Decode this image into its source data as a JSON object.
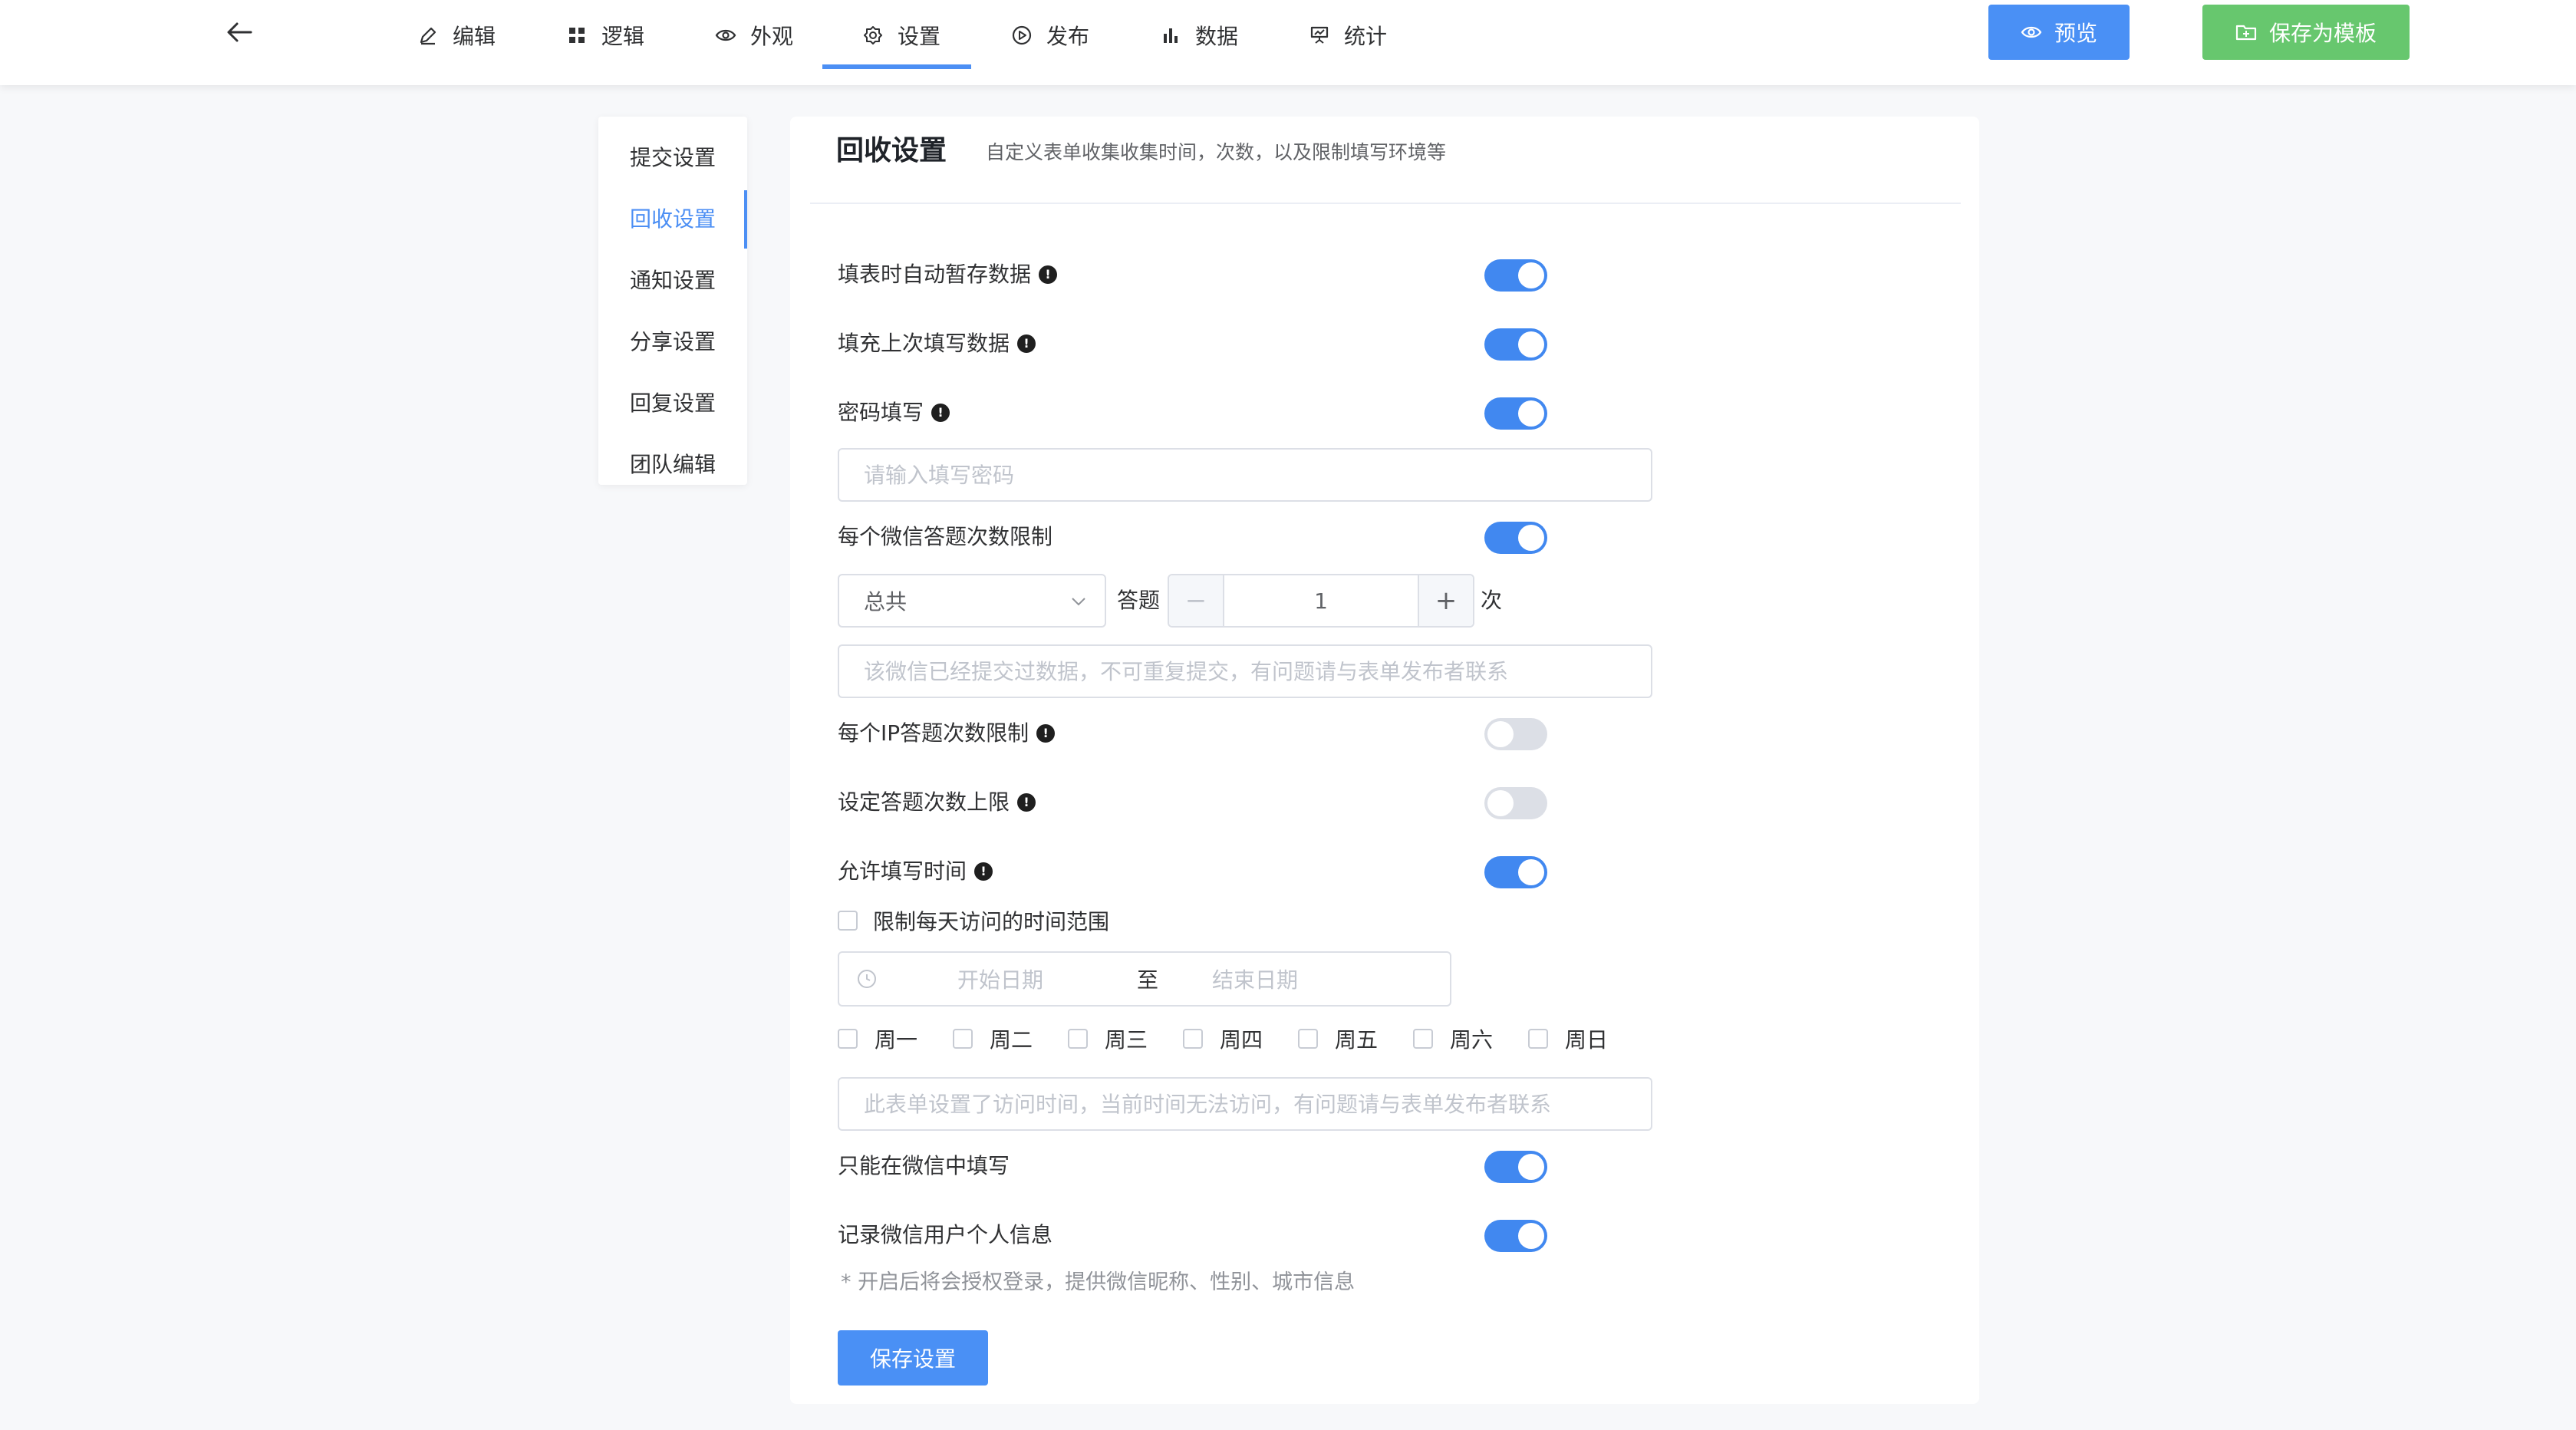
{
  "header": {
    "tabs": [
      {
        "label": "编辑",
        "icon": "edit-icon"
      },
      {
        "label": "逻辑",
        "icon": "grid-icon"
      },
      {
        "label": "外观",
        "icon": "eye-icon"
      },
      {
        "label": "设置",
        "icon": "gear-icon",
        "active": true
      },
      {
        "label": "发布",
        "icon": "play-icon"
      },
      {
        "label": "数据",
        "icon": "bar-chart-icon"
      },
      {
        "label": "统计",
        "icon": "stats-icon"
      }
    ],
    "preview_label": "预览",
    "save_template_label": "保存为模板"
  },
  "side_menu": {
    "items": [
      {
        "label": "提交设置"
      },
      {
        "label": "回收设置",
        "active": true
      },
      {
        "label": "通知设置"
      },
      {
        "label": "分享设置"
      },
      {
        "label": "回复设置"
      },
      {
        "label": "团队编辑"
      }
    ]
  },
  "panel": {
    "title": "回收设置",
    "description": "自定义表单收集收集时间，次数，以及限制填写环境等",
    "auto_save": {
      "label": "填表时自动暂存数据",
      "on": true
    },
    "fill_last": {
      "label": "填充上次填写数据",
      "on": true
    },
    "password": {
      "label": "密码填写",
      "on": true,
      "placeholder": "请输入填写密码"
    },
    "wechat_limit": {
      "label": "每个微信答题次数限制",
      "on": true,
      "period": "总共",
      "answer_label": "答题",
      "count": "1",
      "unit": "次",
      "minus": "−",
      "plus": "+",
      "message_placeholder": "该微信已经提交过数据，不可重复提交，有问题请与表单发布者联系"
    },
    "ip_limit": {
      "label": "每个IP答题次数限制",
      "on": false
    },
    "max_answers": {
      "label": "设定答题次数上限",
      "on": false
    },
    "allow_time": {
      "label": "允许填写时间",
      "on": true,
      "daily_range_label": "限制每天访问的时间范围",
      "start_placeholder": "开始日期",
      "separator": "至",
      "end_placeholder": "结束日期",
      "weekdays": [
        "周一",
        "周二",
        "周三",
        "周四",
        "周五",
        "周六",
        "周日"
      ],
      "message_placeholder": "此表单设置了访问时间，当前时间无法访问，有问题请与表单发布者联系"
    },
    "wechat_only": {
      "label": "只能在微信中填写",
      "on": true
    },
    "record_wechat": {
      "label": "记录微信用户个人信息",
      "on": true
    },
    "hint": "* 开启后将会授权登录，提供微信昵称、性别、城市信息",
    "save_label": "保存设置",
    "info_mark": "!"
  },
  "colors": {
    "accent": "#4a90f5",
    "success": "#67c76e",
    "switch_on": "#4188f0",
    "switch_off": "#dcdfe6"
  }
}
